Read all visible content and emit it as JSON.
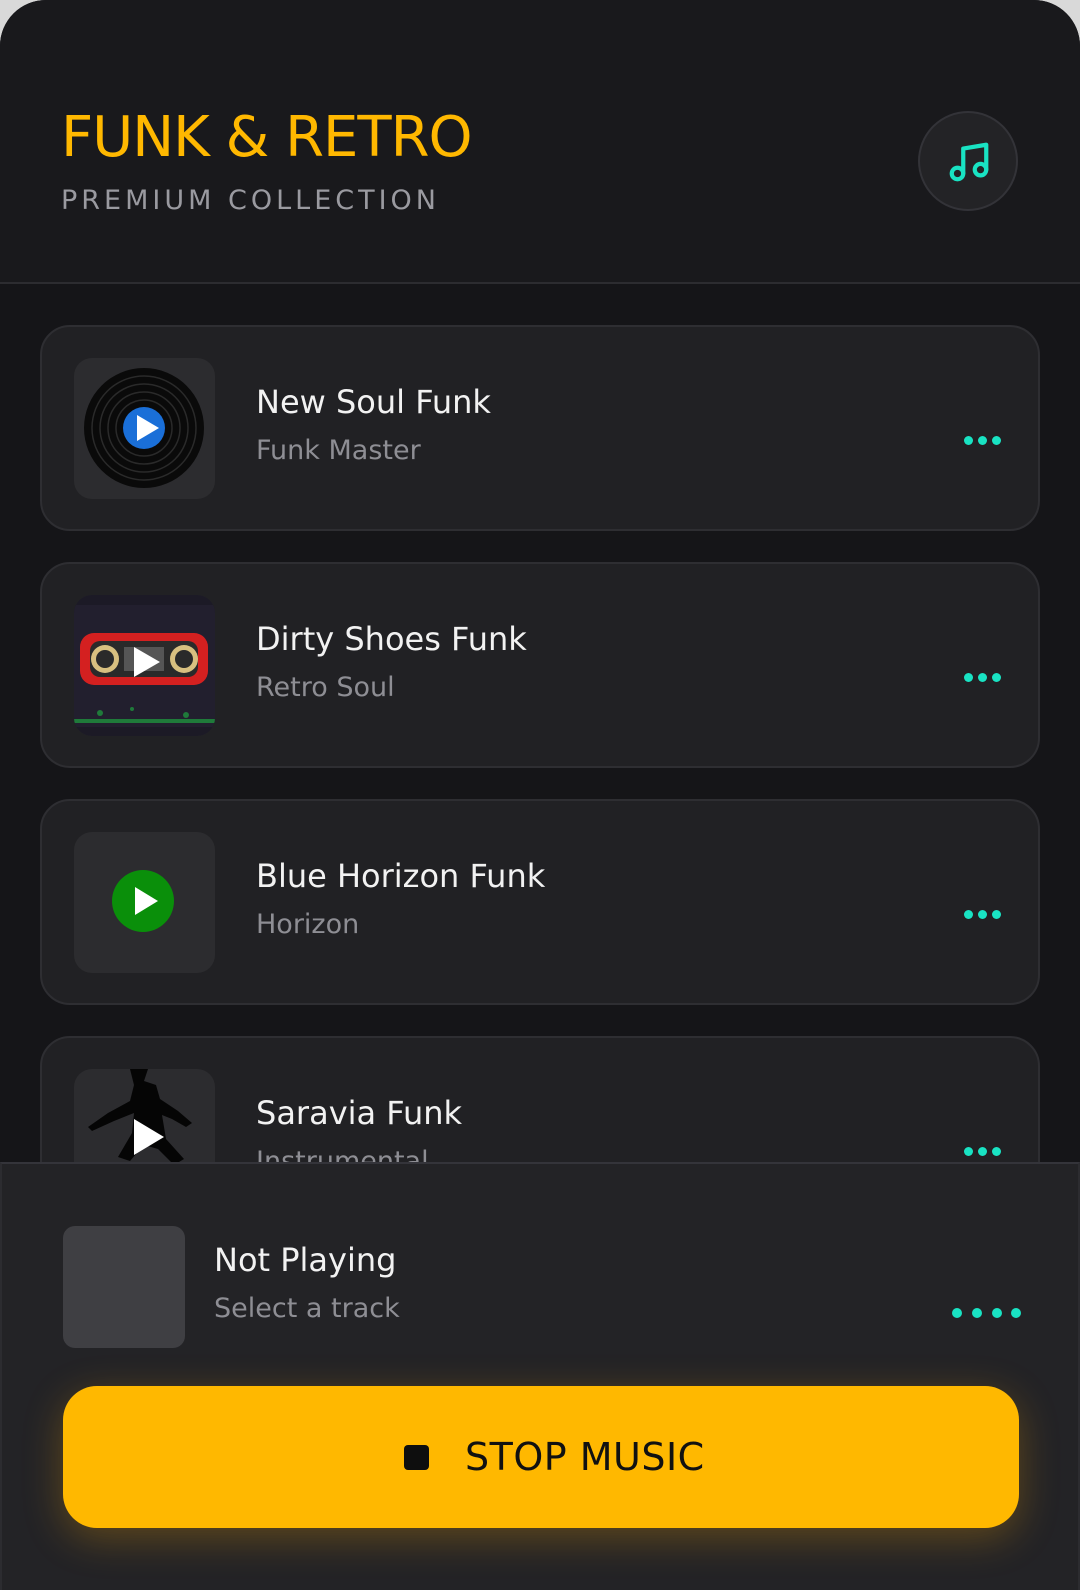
{
  "header": {
    "title": "FUNK & RETRO",
    "subtitle": "PREMIUM COLLECTION",
    "icon": "music-note-icon"
  },
  "tracks": [
    {
      "title": "New Soul Funk",
      "artist": "Funk Master",
      "artwork": "vinyl-record",
      "play_color": "#1a6fd8"
    },
    {
      "title": "Dirty Shoes Funk",
      "artist": "Retro Soul",
      "artwork": "cassette-tape",
      "play_color": "#ffffff"
    },
    {
      "title": "Blue Horizon Funk",
      "artist": "Horizon",
      "artwork": "green-play-circle",
      "play_color": "#0a8f0a"
    },
    {
      "title": "Saravia Funk",
      "artist": "Instrumental",
      "artwork": "dancer-silhouette",
      "play_color": "#ffffff"
    }
  ],
  "player": {
    "title": "Not Playing",
    "subtitle": "Select a track",
    "stop_label": "STOP MUSIC"
  },
  "colors": {
    "accent": "#ffb800",
    "teal": "#19e3c3",
    "background": "#151518",
    "card": "#212124"
  }
}
